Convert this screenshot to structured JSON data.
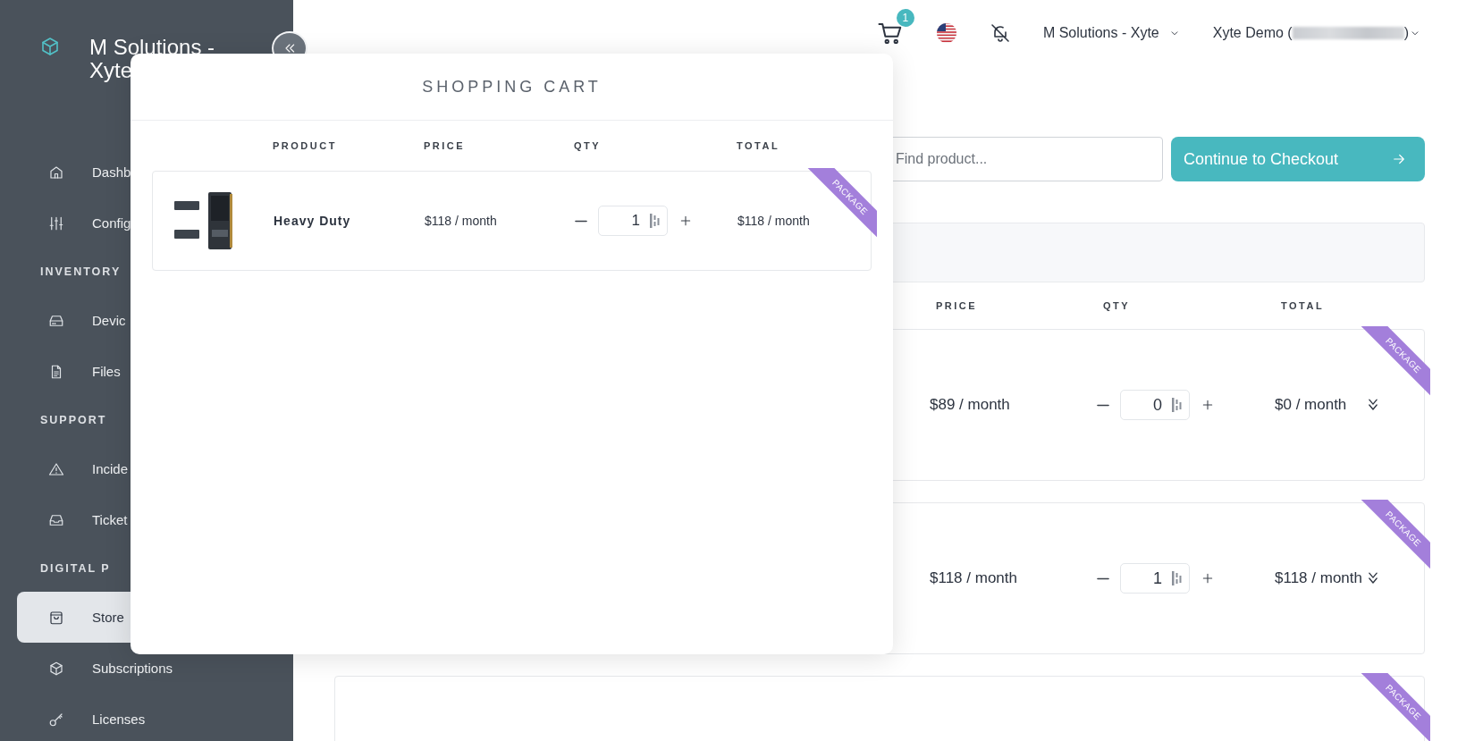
{
  "sidebar": {
    "brand": "M Solutions - Xyte",
    "entries": [
      {
        "kind": "item",
        "label": "Dashb",
        "selected": false
      },
      {
        "kind": "item",
        "label": "Config",
        "selected": false
      },
      {
        "kind": "section",
        "label": "INVENTORY"
      },
      {
        "kind": "item",
        "label": "Devic",
        "selected": false
      },
      {
        "kind": "item",
        "label": "Files",
        "selected": false
      },
      {
        "kind": "section",
        "label": "SUPPORT"
      },
      {
        "kind": "item",
        "label": "Incide",
        "selected": false
      },
      {
        "kind": "item",
        "label": "Ticket",
        "selected": false
      },
      {
        "kind": "section",
        "label": "DIGITAL P"
      },
      {
        "kind": "item",
        "label": "Store",
        "selected": true
      },
      {
        "kind": "item",
        "label": "Subscriptions",
        "selected": false
      },
      {
        "kind": "item",
        "label": "Licenses",
        "selected": false
      }
    ]
  },
  "topbar": {
    "cart_count": "1",
    "organization": "M Solutions - Xyte",
    "user_prefix": "Xyte Demo (",
    "user_suffix": ")"
  },
  "search": {
    "placeholder": "Find product..."
  },
  "checkout_button": "Continue to Checkout",
  "table": {
    "columns": [
      "PRICE",
      "QTY",
      "TOTAL"
    ],
    "rows": [
      {
        "badge": "PACKAGE",
        "price": "$89 / month",
        "qty": "0",
        "total": "$0 / month"
      },
      {
        "badge": "PACKAGE",
        "price": "$118 / month",
        "qty": "1",
        "total": "$118 / month"
      },
      {
        "badge": "PACKAGE"
      }
    ]
  },
  "cart": {
    "title": "SHOPPING CART",
    "columns": [
      "PRODUCT",
      "PRICE",
      "QTY",
      "TOTAL"
    ],
    "items": [
      {
        "name": "Heavy Duty",
        "price": "$118 / month",
        "qty": "1",
        "total": "$118 / month",
        "badge": "PACKAGE"
      }
    ]
  }
}
